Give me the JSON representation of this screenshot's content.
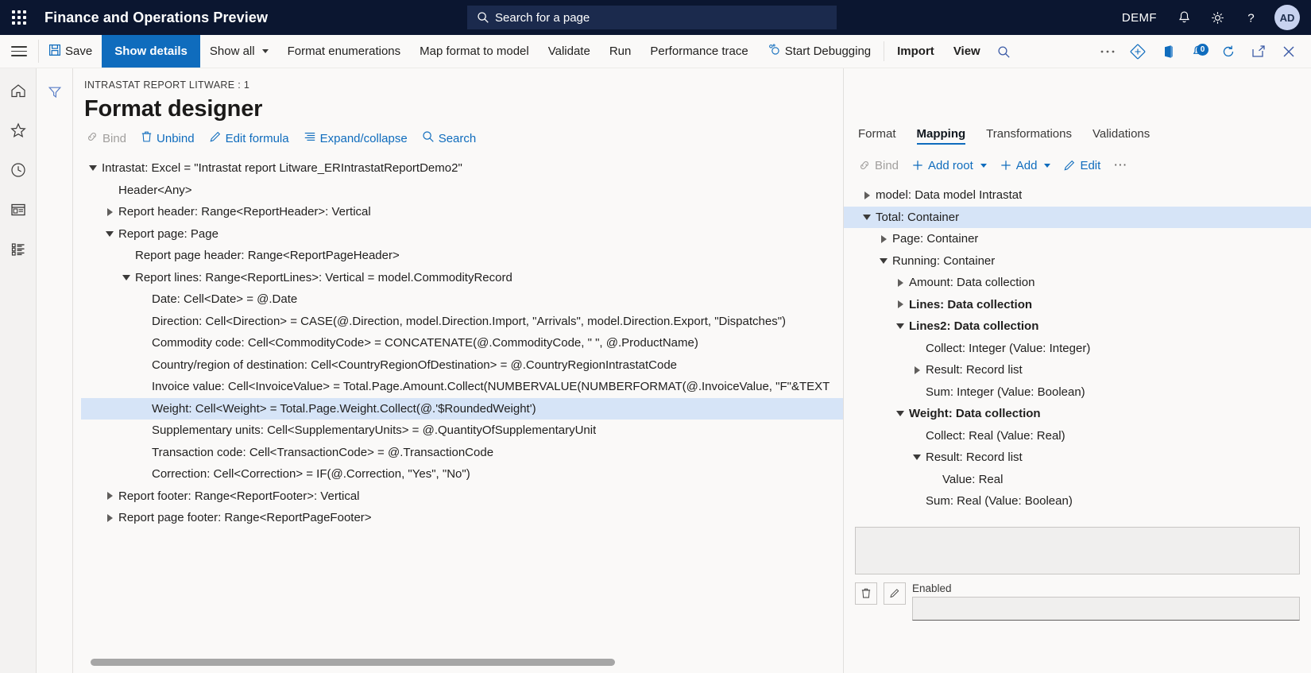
{
  "topbar": {
    "app_title": "Finance and Operations Preview",
    "search_placeholder": "Search for a page",
    "company": "DEMF",
    "avatar_initials": "AD",
    "icons": [
      "waffle-icon",
      "search-icon",
      "bell-icon",
      "gear-icon",
      "help-icon"
    ]
  },
  "commandbar": {
    "save": "Save",
    "show_details": "Show details",
    "show_all": "Show all",
    "format_enumerations": "Format enumerations",
    "map_format_to_model": "Map format to model",
    "validate": "Validate",
    "run": "Run",
    "performance_trace": "Performance trace",
    "start_debugging": "Start Debugging",
    "import": "Import",
    "view": "View",
    "notification_count": "0"
  },
  "navrail": {
    "items": [
      {
        "name": "home-icon"
      },
      {
        "name": "favorites-star-icon"
      },
      {
        "name": "recent-clock-icon"
      },
      {
        "name": "workspaces-icon"
      },
      {
        "name": "modules-list-icon"
      }
    ]
  },
  "designer": {
    "breadcrumb": "INTRASTAT REPORT LITWARE : 1",
    "title": "Format designer",
    "actions": [
      {
        "label": "Bind",
        "icon": "link-icon",
        "disabled": true
      },
      {
        "label": "Unbind",
        "icon": "trash-icon",
        "disabled": false
      },
      {
        "label": "Edit formula",
        "icon": "pencil-icon",
        "disabled": false
      },
      {
        "label": "Expand/collapse",
        "icon": "list-icon",
        "disabled": false
      },
      {
        "label": "Search",
        "icon": "search-icon",
        "disabled": false
      }
    ],
    "tree": [
      {
        "label": "Intrastat: Excel = \"Intrastat report Litware_ERIntrastatReportDemo2\"",
        "indent": 0,
        "twisty": "down",
        "selected": false
      },
      {
        "label": "Header<Any>",
        "indent": 1,
        "twisty": "none",
        "selected": false
      },
      {
        "label": "Report header: Range<ReportHeader>: Vertical",
        "indent": 1,
        "twisty": "right",
        "selected": false
      },
      {
        "label": "Report page: Page",
        "indent": 1,
        "twisty": "down",
        "selected": false
      },
      {
        "label": "Report page header: Range<ReportPageHeader>",
        "indent": 2,
        "twisty": "none",
        "selected": false
      },
      {
        "label": "Report lines: Range<ReportLines>: Vertical = model.CommodityRecord",
        "indent": 2,
        "twisty": "down",
        "selected": false
      },
      {
        "label": "Date: Cell<Date> = @.Date",
        "indent": 3,
        "twisty": "none",
        "selected": false
      },
      {
        "label": "Direction: Cell<Direction> = CASE(@.Direction, model.Direction.Import, \"Arrivals\", model.Direction.Export, \"Dispatches\")",
        "indent": 3,
        "twisty": "none",
        "selected": false
      },
      {
        "label": "Commodity code: Cell<CommodityCode> = CONCATENATE(@.CommodityCode, \" \", @.ProductName)",
        "indent": 3,
        "twisty": "none",
        "selected": false
      },
      {
        "label": "Country/region of destination: Cell<CountryRegionOfDestination> = @.CountryRegionIntrastatCode",
        "indent": 3,
        "twisty": "none",
        "selected": false
      },
      {
        "label": "Invoice value: Cell<InvoiceValue> = Total.Page.Amount.Collect(NUMBERVALUE(NUMBERFORMAT(@.InvoiceValue, \"F\"&TEXT",
        "indent": 3,
        "twisty": "none",
        "selected": false
      },
      {
        "label": "Weight: Cell<Weight> = Total.Page.Weight.Collect(@.'$RoundedWeight')",
        "indent": 3,
        "twisty": "none",
        "selected": true
      },
      {
        "label": "Supplementary units: Cell<SupplementaryUnits> = @.QuantityOfSupplementaryUnit",
        "indent": 3,
        "twisty": "none",
        "selected": false
      },
      {
        "label": "Transaction code: Cell<TransactionCode> = @.TransactionCode",
        "indent": 3,
        "twisty": "none",
        "selected": false
      },
      {
        "label": "Correction: Cell<Correction> = IF(@.Correction, \"Yes\", \"No\")",
        "indent": 3,
        "twisty": "none",
        "selected": false
      },
      {
        "label": "Report footer: Range<ReportFooter>: Vertical",
        "indent": 1,
        "twisty": "right",
        "selected": false
      },
      {
        "label": "Report page footer: Range<ReportPageFooter>",
        "indent": 1,
        "twisty": "right",
        "selected": false
      }
    ]
  },
  "mapping": {
    "tabs": [
      {
        "label": "Format",
        "active": false
      },
      {
        "label": "Mapping",
        "active": true
      },
      {
        "label": "Transformations",
        "active": false
      },
      {
        "label": "Validations",
        "active": false
      }
    ],
    "actions": [
      {
        "label": "Bind",
        "icon": "link-icon",
        "disabled": true,
        "caret": false,
        "plus": false
      },
      {
        "label": "Add root",
        "icon": "plus-icon",
        "disabled": false,
        "caret": true,
        "plus": true
      },
      {
        "label": "Add",
        "icon": "plus-icon",
        "disabled": false,
        "caret": true,
        "plus": true
      },
      {
        "label": "Edit",
        "icon": "pencil-icon",
        "disabled": false,
        "caret": false,
        "plus": false
      },
      {
        "label": "⋯",
        "icon": "more-icon",
        "disabled": false,
        "caret": false,
        "plus": false
      }
    ],
    "tree": [
      {
        "label": "model: Data model Intrastat",
        "indent": 0,
        "twisty": "right",
        "selected": false,
        "bold": false
      },
      {
        "label": "Total: Container",
        "indent": 0,
        "twisty": "down",
        "selected": true,
        "bold": false
      },
      {
        "label": "Page: Container",
        "indent": 1,
        "twisty": "right",
        "selected": false,
        "bold": false
      },
      {
        "label": "Running: Container",
        "indent": 1,
        "twisty": "down",
        "selected": false,
        "bold": false
      },
      {
        "label": "Amount: Data collection",
        "indent": 2,
        "twisty": "right",
        "selected": false,
        "bold": false
      },
      {
        "label": "Lines: Data collection",
        "indent": 2,
        "twisty": "right",
        "selected": false,
        "bold": true
      },
      {
        "label": "Lines2: Data collection",
        "indent": 2,
        "twisty": "down",
        "selected": false,
        "bold": true
      },
      {
        "label": "Collect: Integer (Value: Integer)",
        "indent": 3,
        "twisty": "none",
        "selected": false,
        "bold": false
      },
      {
        "label": "Result: Record list",
        "indent": 3,
        "twisty": "right",
        "selected": false,
        "bold": false
      },
      {
        "label": "Sum: Integer (Value: Boolean)",
        "indent": 3,
        "twisty": "none",
        "selected": false,
        "bold": false
      },
      {
        "label": "Weight: Data collection",
        "indent": 2,
        "twisty": "down",
        "selected": false,
        "bold": true
      },
      {
        "label": "Collect: Real (Value: Real)",
        "indent": 3,
        "twisty": "none",
        "selected": false,
        "bold": false
      },
      {
        "label": "Result: Record list",
        "indent": 3,
        "twisty": "down",
        "selected": false,
        "bold": false
      },
      {
        "label": "Value: Real",
        "indent": 4,
        "twisty": "none",
        "selected": false,
        "bold": false
      },
      {
        "label": "Sum: Real (Value: Boolean)",
        "indent": 3,
        "twisty": "none",
        "selected": false,
        "bold": false
      }
    ],
    "enabled_label": "Enabled",
    "enabled_value": ""
  },
  "colors": {
    "topbar_bg": "#0b1630",
    "accent": "#0f6cbd",
    "selection": "#d6e4f7",
    "page_bg": "#faf9f8"
  }
}
